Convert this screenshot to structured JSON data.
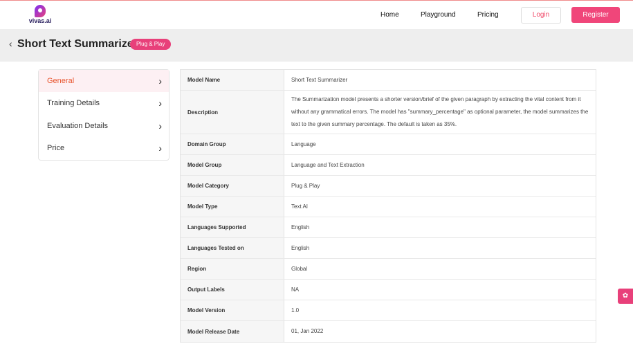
{
  "brand": {
    "name": "vivas.ai"
  },
  "nav": {
    "home": "Home",
    "playground": "Playground",
    "pricing": "Pricing",
    "login": "Login",
    "register": "Register"
  },
  "header": {
    "back_icon": "‹",
    "title": "Short Text Summarizer",
    "badge": "Plug & Play"
  },
  "menu": {
    "items": [
      {
        "label": "General",
        "active": true
      },
      {
        "label": "Training Details"
      },
      {
        "label": "Evaluation Details"
      },
      {
        "label": "Price"
      }
    ],
    "chevron": "›"
  },
  "details": [
    {
      "key": "Model Name",
      "value": "Short Text Summarizer"
    },
    {
      "key": "Description",
      "value": "The Summarization model presents a shorter version/brief of the given paragraph by extracting the vital content from it without any grammatical errors. The model has \"summary_percentage\" as optional parameter, the model summarizes the text to the given summary percentage. The default is taken as 35%."
    },
    {
      "key": "Domain Group",
      "value": "Language"
    },
    {
      "key": "Model Group",
      "value": "Language and Text Extraction"
    },
    {
      "key": "Model Category",
      "value": "Plug & Play"
    },
    {
      "key": "Model Type",
      "value": "Text AI"
    },
    {
      "key": "Languages Supported",
      "value": "English"
    },
    {
      "key": "Languages Tested on",
      "value": "English"
    },
    {
      "key": "Region",
      "value": "Global"
    },
    {
      "key": "Output Labels",
      "value": "NA"
    },
    {
      "key": "Model Version",
      "value": "1.0"
    },
    {
      "key": "Model Release Date",
      "value": "01, Jan 2022"
    }
  ],
  "float_button": {
    "icon": "✿"
  },
  "colors": {
    "accent": "#e8407a",
    "active_text": "#e8552e"
  }
}
